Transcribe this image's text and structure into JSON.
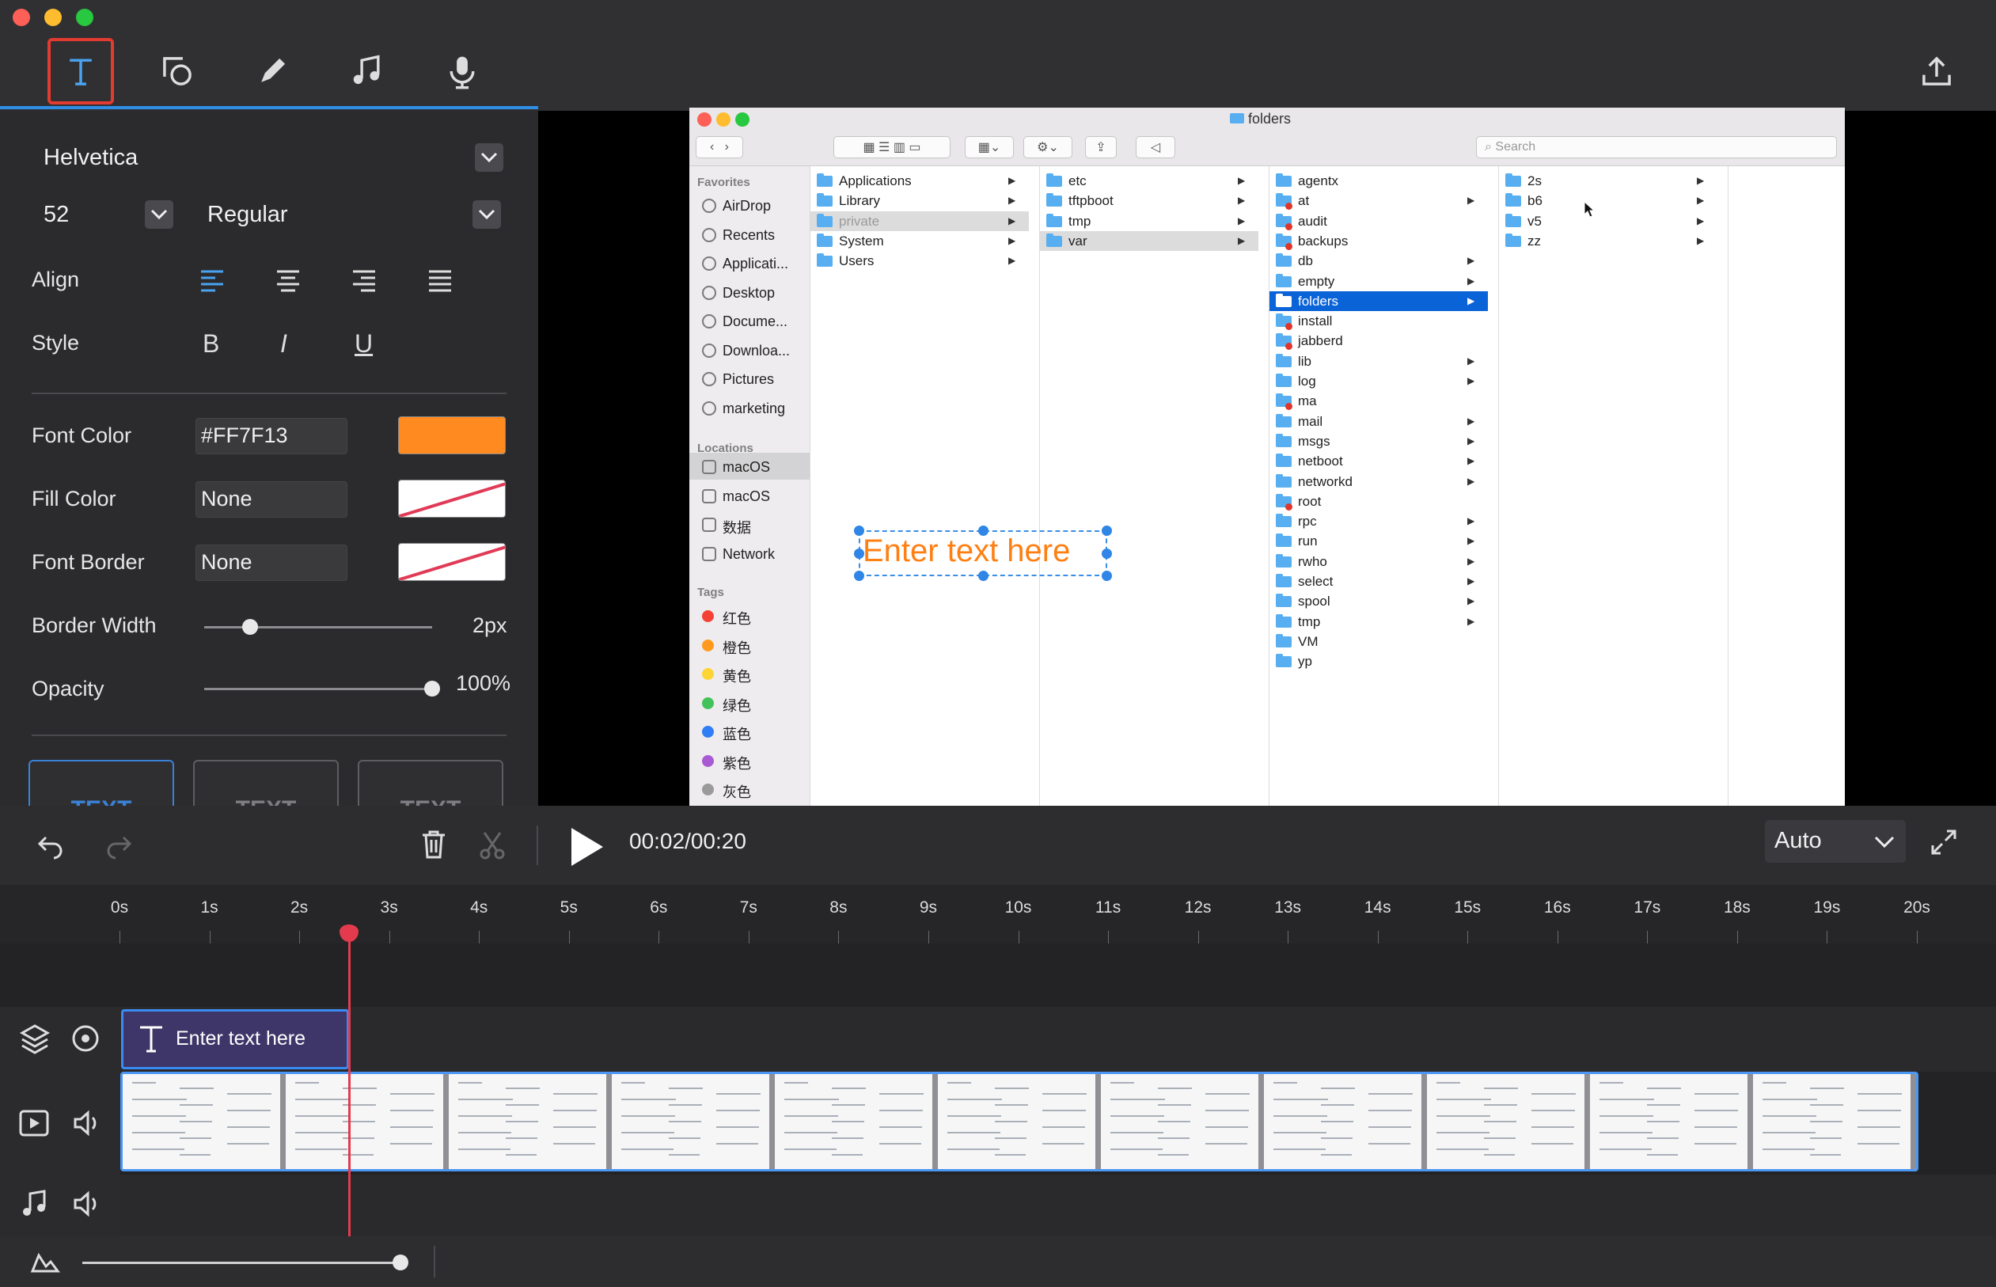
{
  "window": {
    "traffic_lights": [
      "#fe5f57",
      "#febc2e",
      "#28c840"
    ]
  },
  "toolbar": {
    "tools": [
      "text-icon",
      "shape-icon",
      "pen-icon",
      "music-icon",
      "microphone-icon"
    ],
    "selected": "text-icon",
    "export_icon": "upload-icon"
  },
  "panel": {
    "font_family": "Helvetica",
    "font_size": "52",
    "font_weight": "Regular",
    "align_label": "Align",
    "style_label": "Style",
    "style_buttons": [
      "B",
      "I",
      "U"
    ],
    "font_color_label": "Font Color",
    "font_color_value": "#FF7F13",
    "font_color_swatch": "#ff8a1f",
    "fill_color_label": "Fill Color",
    "fill_color_value": "None",
    "font_border_label": "Font Border",
    "font_border_value": "None",
    "border_width_label": "Border Width",
    "border_width_value": "2px",
    "border_width_level": 0.2,
    "opacity_label": "Opacity",
    "opacity_value": "100%",
    "opacity_level": 1.0,
    "presets": [
      "TEXT",
      "TEXT",
      "TEXT"
    ]
  },
  "finder": {
    "title": "folders",
    "search_placeholder": "Search",
    "sidebar": {
      "favorites_header": "Favorites",
      "favorites": [
        "AirDrop",
        "Recents",
        "Applicati...",
        "Desktop",
        "Docume...",
        "Downloa...",
        "Pictures",
        "marketing"
      ],
      "locations_header": "Locations",
      "locations": [
        "macOS",
        "macOS",
        "数据",
        "Network"
      ],
      "tags_header": "Tags",
      "tags": [
        {
          "name": "红色",
          "color": "#f44336"
        },
        {
          "name": "橙色",
          "color": "#ff9a1f"
        },
        {
          "name": "黄色",
          "color": "#fdd535"
        },
        {
          "name": "绿色",
          "color": "#42c25a"
        },
        {
          "name": "蓝色",
          "color": "#2f7ef6"
        },
        {
          "name": "紫色",
          "color": "#a75ad3"
        },
        {
          "name": "灰色",
          "color": "#9a9a9a"
        }
      ]
    },
    "col1": [
      "Applications",
      "Library",
      "private",
      "System",
      "Users"
    ],
    "col2": [
      "etc",
      "tftpboot",
      "tmp",
      "var"
    ],
    "col3": [
      "agentx",
      "at",
      "audit",
      "backups",
      "db",
      "empty",
      "folders",
      "install",
      "jabberd",
      "lib",
      "log",
      "ma",
      "mail",
      "msgs",
      "netboot",
      "networkd",
      "root",
      "rpc",
      "run",
      "rwho",
      "select",
      "spool",
      "tmp",
      "VM",
      "yp"
    ],
    "col4": [
      "2s",
      "b6",
      "v5",
      "zz"
    ]
  },
  "overlay_text": "Enter text here",
  "controls": {
    "timecode": "00:02/00:20",
    "zoom": "Auto"
  },
  "timeline": {
    "ticks": [
      "0s",
      "1s",
      "2s",
      "3s",
      "4s",
      "5s",
      "6s",
      "7s",
      "8s",
      "9s",
      "10s",
      "11s",
      "12s",
      "13s",
      "14s",
      "15s",
      "16s",
      "17s",
      "18s",
      "19s",
      "20s"
    ],
    "playhead_seconds": 2.55,
    "text_clip_label": "Enter text here"
  }
}
